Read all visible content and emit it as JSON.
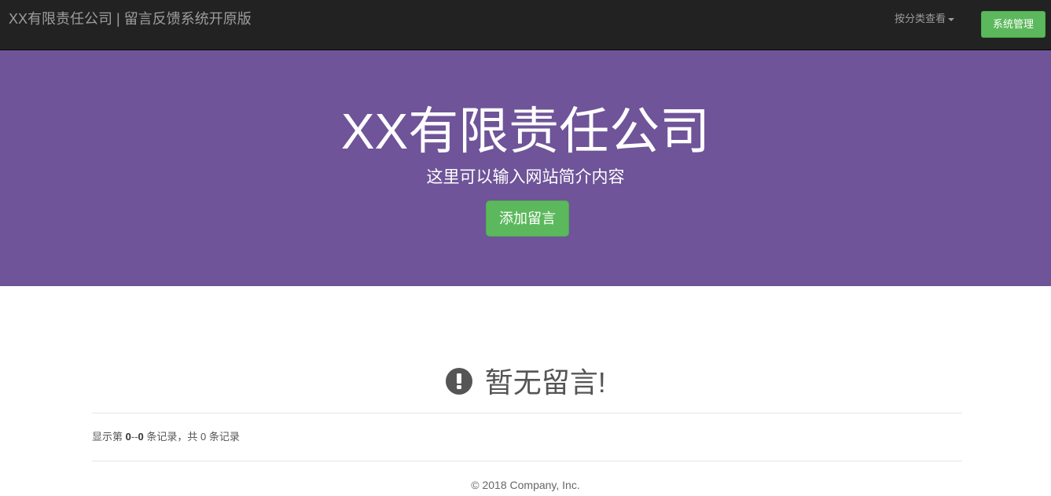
{
  "navbar": {
    "brand": "XX有限责任公司 | 留言反馈系统开原版",
    "category_menu": "按分类查看",
    "admin_button": "系统管理"
  },
  "hero": {
    "title": "XX有限责任公司",
    "subtitle": "这里可以输入网站简介内容",
    "add_button": "添加留言"
  },
  "empty_state": {
    "icon": "exclamation-circle-icon",
    "message": "暂无留言!"
  },
  "records": {
    "prefix": "显示第",
    "range_start": "0",
    "range_sep": "--",
    "range_end": "0",
    "middle": "条记录，共",
    "total": "0",
    "suffix": "条记录"
  },
  "footer": {
    "copyright": "© 2018 Company, Inc."
  },
  "colors": {
    "navbar_bg": "#222222",
    "hero_bg": "#6f5499",
    "success": "#5cb85c"
  }
}
